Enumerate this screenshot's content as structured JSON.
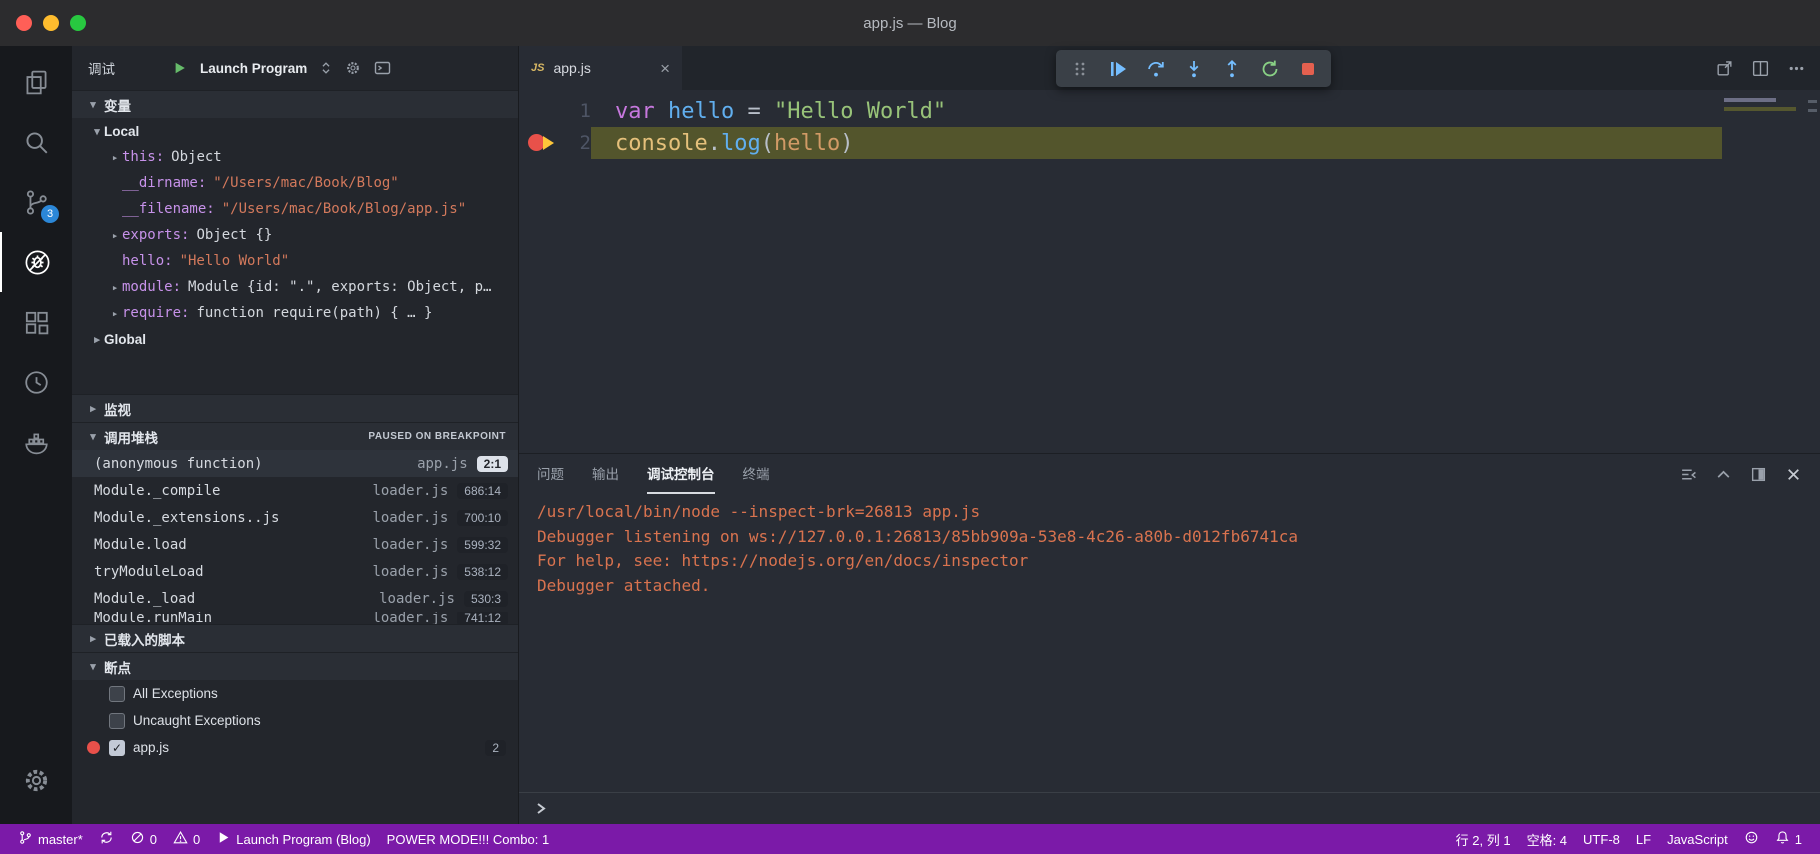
{
  "titlebar": {
    "title": "app.js — Blog"
  },
  "activity_bar": {
    "items": [
      "files-icon",
      "search-icon",
      "source-control-icon",
      "debug-icon",
      "extensions-icon",
      "history-icon",
      "docker-icon",
      "gear-icon"
    ],
    "active_item": "debug",
    "source_control_badge": "3"
  },
  "sidebar": {
    "title": "调试",
    "launch_config": "Launch Program",
    "sections": {
      "variables": {
        "label": "变量"
      },
      "watch": {
        "label": "监视"
      },
      "call_stack": {
        "label": "调用堆栈",
        "status": "PAUSED ON BREAKPOINT"
      },
      "loaded_scripts": {
        "label": "已载入的脚本"
      },
      "breakpoints": {
        "label": "断点"
      }
    },
    "scopes": [
      {
        "label": "Local",
        "expanded": true
      },
      {
        "label": "Global",
        "expanded": false
      }
    ],
    "variables": [
      {
        "name": "this",
        "value": "Object",
        "kind": "object",
        "expandable": true
      },
      {
        "name": "__dirname",
        "value": "\"/Users/mac/Book/Blog\"",
        "kind": "string",
        "expandable": false
      },
      {
        "name": "__filename",
        "value": "\"/Users/mac/Book/Blog/app.js\"",
        "kind": "string",
        "expandable": false
      },
      {
        "name": "exports",
        "value": "Object {}",
        "kind": "object",
        "expandable": true
      },
      {
        "name": "hello",
        "value": "\"Hello World\"",
        "kind": "string",
        "expandable": false
      },
      {
        "name": "module",
        "value": "Module {id: \".\", exports: Object, p…",
        "kind": "object",
        "expandable": true
      },
      {
        "name": "require",
        "value": "function require(path) { … }",
        "kind": "function",
        "expandable": true
      }
    ],
    "call_stack_frames": [
      {
        "name": "(anonymous function)",
        "file": "app.js",
        "pos": "2:1",
        "selected": true
      },
      {
        "name": "Module._compile",
        "file": "loader.js",
        "pos": "686:14"
      },
      {
        "name": "Module._extensions..js",
        "file": "loader.js",
        "pos": "700:10"
      },
      {
        "name": "Module.load",
        "file": "loader.js",
        "pos": "599:32"
      },
      {
        "name": "tryModuleLoad",
        "file": "loader.js",
        "pos": "538:12"
      },
      {
        "name": "Module._load",
        "file": "loader.js",
        "pos": "530:3"
      },
      {
        "name": "Module.runMain",
        "file": "loader.js",
        "pos": "741:12",
        "clipped": true
      }
    ],
    "breakpoints": [
      {
        "label": "All Exceptions",
        "checked": false,
        "dot": false
      },
      {
        "label": "Uncaught Exceptions",
        "checked": false,
        "dot": false
      },
      {
        "label": "app.js",
        "checked": true,
        "dot": true,
        "badge": "2"
      }
    ]
  },
  "editor": {
    "tab": {
      "icon_label": "JS",
      "title": "app.js",
      "close_glyph": "×"
    },
    "code": [
      {
        "num": "1",
        "current": false,
        "breakpoint": false,
        "tokens": [
          {
            "text": "var",
            "style": "keyword"
          },
          {
            "text": " ",
            "style": "plain"
          },
          {
            "text": "hello",
            "style": "variable"
          },
          {
            "text": " ",
            "style": "plain"
          },
          {
            "text": "=",
            "style": "operator"
          },
          {
            "text": " ",
            "style": "plain"
          },
          {
            "text": "\"Hello World\"",
            "style": "string"
          }
        ]
      },
      {
        "num": "2",
        "current": true,
        "breakpoint": true,
        "tokens": [
          {
            "text": "console",
            "style": "builtin"
          },
          {
            "text": ".",
            "style": "operator"
          },
          {
            "text": "log",
            "style": "function"
          },
          {
            "text": "(",
            "style": "operator"
          },
          {
            "text": "hello",
            "style": "argument"
          },
          {
            "text": ")",
            "style": "operator"
          }
        ]
      }
    ]
  },
  "debug_toolbar": {
    "buttons": [
      "drag-handle",
      "continue",
      "step-over",
      "step-into",
      "step-out",
      "restart",
      "stop"
    ]
  },
  "panel": {
    "tabs": [
      {
        "label": "问题",
        "active": false
      },
      {
        "label": "输出",
        "active": false
      },
      {
        "label": "调试控制台",
        "active": true
      },
      {
        "label": "终端",
        "active": false
      }
    ],
    "console_lines": [
      "/usr/local/bin/node --inspect-brk=26813 app.js",
      "Debugger listening on ws://127.0.0.1:26813/85bb909a-53e8-4c26-a80b-d012fb6741ca",
      "For help, see: https://nodejs.org/en/docs/inspector",
      "Debugger attached."
    ],
    "prompt": "❯"
  },
  "statusbar": {
    "left": [
      {
        "icon": "git-branch-icon",
        "label": "master*",
        "name": "git-branch"
      },
      {
        "icon": "sync-icon",
        "label": "",
        "name": "sync"
      },
      {
        "icon": "error-icon",
        "label": "0",
        "name": "errors"
      },
      {
        "icon": "warning-icon",
        "label": "0",
        "name": "warnings"
      },
      {
        "icon": "play-icon",
        "label": "Launch Program (Blog)",
        "name": "launch-config"
      },
      {
        "icon": "",
        "label": "POWER MODE!!! Combo: 1",
        "name": "power-mode"
      }
    ],
    "right": [
      {
        "icon": "",
        "label": "行 2, 列 1",
        "name": "cursor-position"
      },
      {
        "icon": "",
        "label": "空格: 4",
        "name": "indentation"
      },
      {
        "icon": "",
        "label": "UTF-8",
        "name": "encoding"
      },
      {
        "icon": "",
        "label": "LF",
        "name": "eol"
      },
      {
        "icon": "",
        "label": "JavaScript",
        "name": "language-mode"
      },
      {
        "icon": "feedback-icon",
        "label": "",
        "name": "feedback"
      },
      {
        "icon": "bell-icon",
        "label": "1",
        "name": "notifications"
      }
    ]
  },
  "colors": {
    "statusbar_bg": "#7b1aa8",
    "debug_blue": "#75beff",
    "restart_green": "#89d185",
    "stop_red": "#e4604f",
    "breakpoint_red": "#e8514a",
    "current_line_bg": "#53552c",
    "badge_blue": "#2b87d8",
    "string_orange": "#d3795c",
    "console_text": "#d9734f"
  }
}
